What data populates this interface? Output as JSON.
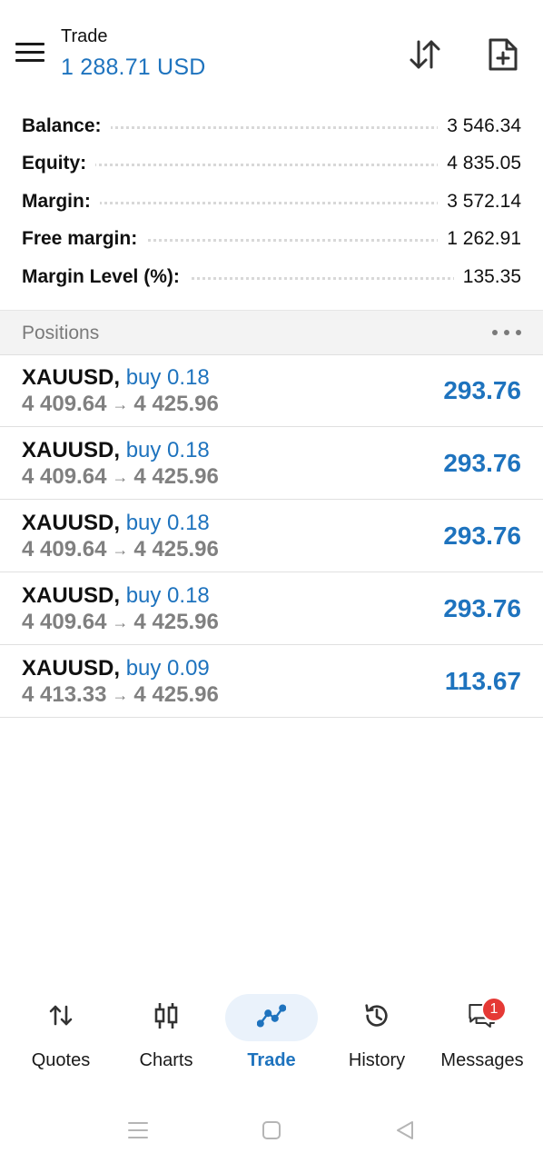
{
  "header": {
    "title": "Trade",
    "balance": "1 288.71 USD"
  },
  "summary": [
    {
      "label": "Balance:",
      "value": "3 546.34"
    },
    {
      "label": "Equity:",
      "value": "4 835.05"
    },
    {
      "label": "Margin:",
      "value": "3 572.14"
    },
    {
      "label": "Free margin:",
      "value": "1 262.91"
    },
    {
      "label": "Margin Level (%):",
      "value": "135.35"
    }
  ],
  "positions_header": {
    "title": "Positions"
  },
  "positions": [
    {
      "symbol": "XAUUSD,",
      "side": "buy 0.18",
      "open": "4 409.64",
      "arrow": "→",
      "current": "4 425.96",
      "profit": "293.76"
    },
    {
      "symbol": "XAUUSD,",
      "side": "buy 0.18",
      "open": "4 409.64",
      "arrow": "→",
      "current": "4 425.96",
      "profit": "293.76"
    },
    {
      "symbol": "XAUUSD,",
      "side": "buy 0.18",
      "open": "4 409.64",
      "arrow": "→",
      "current": "4 425.96",
      "profit": "293.76"
    },
    {
      "symbol": "XAUUSD,",
      "side": "buy 0.18",
      "open": "4 409.64",
      "arrow": "→",
      "current": "4 425.96",
      "profit": "293.76"
    },
    {
      "symbol": "XAUUSD,",
      "side": "buy 0.09",
      "open": "4 413.33",
      "arrow": "→",
      "current": "4 425.96",
      "profit": "113.67"
    }
  ],
  "bottom_nav": {
    "items": [
      {
        "label": "Quotes",
        "icon": "quotes-icon"
      },
      {
        "label": "Charts",
        "icon": "charts-icon"
      },
      {
        "label": "Trade",
        "icon": "trade-icon"
      },
      {
        "label": "History",
        "icon": "history-icon"
      },
      {
        "label": "Messages",
        "icon": "messages-icon"
      }
    ],
    "active": "Trade",
    "messages_badge": "1"
  },
  "colors": {
    "accent": "#1e73be",
    "muted": "#808080",
    "badge": "#e53935"
  }
}
